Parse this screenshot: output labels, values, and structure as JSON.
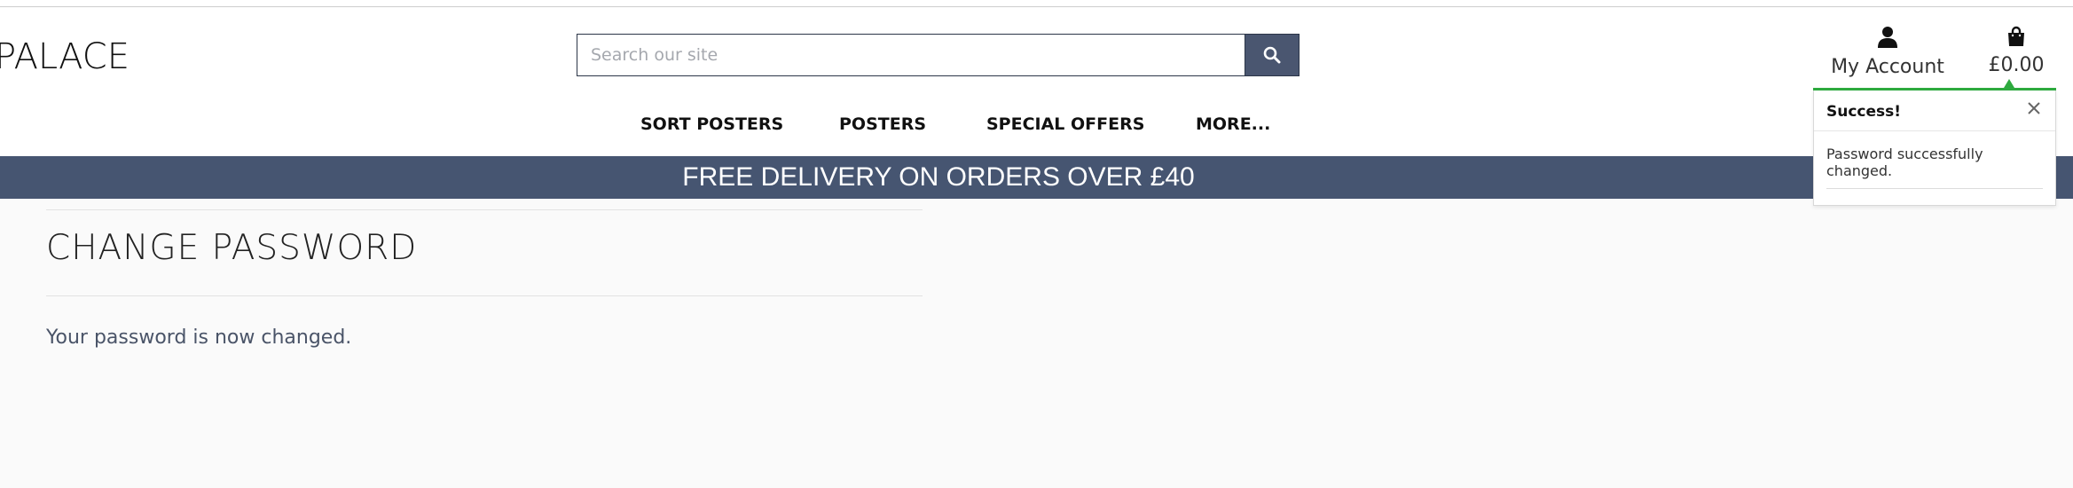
{
  "header": {
    "logo_text": "PALACE",
    "search": {
      "placeholder": "Search our site",
      "value": ""
    },
    "account_label": "My Account",
    "bag_total": "£0.00"
  },
  "nav": {
    "items": [
      "SORT POSTERS",
      "POSTERS",
      "SPECIAL OFFERS",
      "MORE..."
    ]
  },
  "banner": {
    "text": "FREE DELIVERY ON ORDERS OVER £40"
  },
  "main": {
    "title": "CHANGE PASSWORD",
    "message": "Your password is now changed."
  },
  "toast": {
    "title": "Success!",
    "message": "Password successfully changed.",
    "accent_color": "#2eaa3f"
  },
  "colors": {
    "brand": "#465571",
    "search_button": "#4a5670"
  },
  "icons": [
    "search-icon",
    "user-icon",
    "shopping-bag-icon",
    "close-icon"
  ]
}
